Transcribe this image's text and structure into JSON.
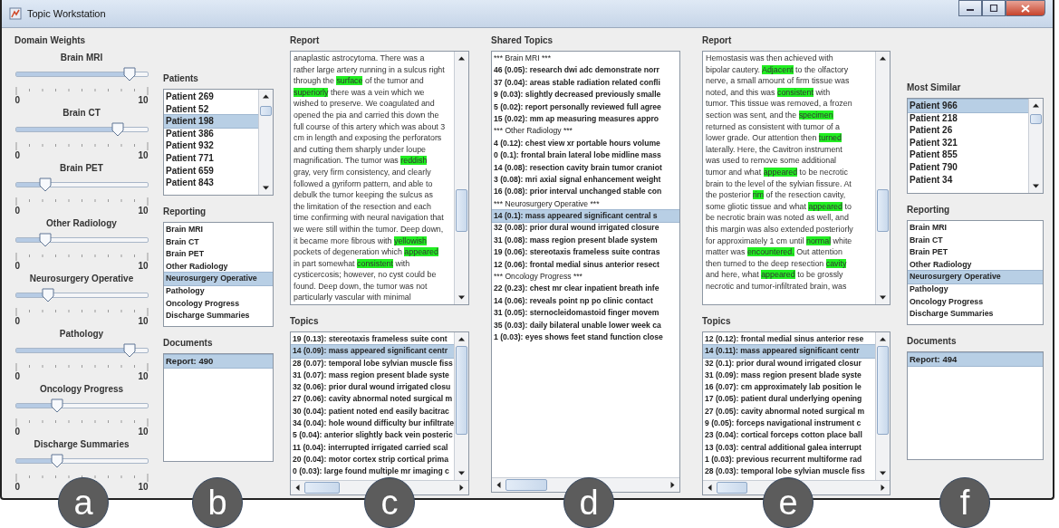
{
  "window": {
    "title": "Topic Workstation"
  },
  "domain_weights": {
    "title": "Domain Weights",
    "sliders": [
      {
        "label": "Brain MRI",
        "level": 0.9,
        "min": "0",
        "max": "10"
      },
      {
        "label": "Brain CT",
        "level": 0.8,
        "min": "0",
        "max": "10"
      },
      {
        "label": "Brain PET",
        "level": 0.2,
        "min": "0",
        "max": "10"
      },
      {
        "label": "Other Radiology",
        "level": 0.2,
        "min": "0",
        "max": "10"
      },
      {
        "label": "Neurosurgery Operative",
        "level": 0.22,
        "min": "0",
        "max": "10"
      },
      {
        "label": "Pathology",
        "level": 0.9,
        "min": "0",
        "max": "10"
      },
      {
        "label": "Oncology Progress",
        "level": 0.3,
        "min": "0",
        "max": "10"
      },
      {
        "label": "Discharge Summaries",
        "level": 0.3,
        "min": "0",
        "max": "10"
      }
    ]
  },
  "patients": {
    "title": "Patients",
    "items": [
      {
        "label": "Patient 269",
        "selected": false
      },
      {
        "label": "Patient 52",
        "selected": false
      },
      {
        "label": "Patient 198",
        "selected": true
      },
      {
        "label": "Patient 386",
        "selected": false
      },
      {
        "label": "Patient 932",
        "selected": false
      },
      {
        "label": "Patient 771",
        "selected": false
      },
      {
        "label": "Patient 659",
        "selected": false
      },
      {
        "label": "Patient 843",
        "selected": false
      }
    ]
  },
  "reporting_left": {
    "title": "Reporting",
    "items": [
      {
        "label": "Brain MRI",
        "selected": false
      },
      {
        "label": "Brain CT",
        "selected": false
      },
      {
        "label": "Brain PET",
        "selected": false
      },
      {
        "label": "Other Radiology",
        "selected": false
      },
      {
        "label": "Neurosurgery Operative",
        "selected": true
      },
      {
        "label": "Pathology",
        "selected": false
      },
      {
        "label": "Oncology Progress",
        "selected": false
      },
      {
        "label": "Discharge Summaries",
        "selected": false
      }
    ]
  },
  "documents_left": {
    "title": "Documents",
    "items": [
      {
        "label": "Report: 490",
        "selected": true
      }
    ]
  },
  "report_left": {
    "title": "Report",
    "lines": [
      [
        {
          "text": "anaplastic astrocytoma. There was a",
          "highlighted": false
        }
      ],
      [
        {
          "text": "rather large artery running in a sulcus right",
          "highlighted": false
        }
      ],
      [
        {
          "text": "through the ",
          "highlighted": false
        },
        {
          "text": "surface",
          "highlighted": true
        },
        {
          "text": " of the tumor and",
          "highlighted": false
        }
      ],
      [
        {
          "text": "superiorly",
          "highlighted": true
        },
        {
          "text": " there was a vein which we",
          "highlighted": false
        }
      ],
      [
        {
          "text": "wished to preserve. We coagulated and",
          "highlighted": false
        }
      ],
      [
        {
          "text": "opened the pia and carried this down the",
          "highlighted": false
        }
      ],
      [
        {
          "text": "full course of this artery which was about 3",
          "highlighted": false
        }
      ],
      [
        {
          "text": "cm in length and exposing the perforators",
          "highlighted": false
        }
      ],
      [
        {
          "text": "and cutting them sharply under loupe",
          "highlighted": false
        }
      ],
      [
        {
          "text": "magnification. The tumor was ",
          "highlighted": false
        },
        {
          "text": "reddish",
          "highlighted": true
        }
      ],
      [
        {
          "text": "gray, very firm consistency, and clearly",
          "highlighted": false
        }
      ],
      [
        {
          "text": "followed a gyriform pattern, and able to",
          "highlighted": false
        }
      ],
      [
        {
          "text": "debulk the tumor keeping the sulcus as",
          "highlighted": false
        }
      ],
      [
        {
          "text": "the limitation of the resection and each",
          "highlighted": false
        }
      ],
      [
        {
          "text": "time confirming with neural navigation that",
          "highlighted": false
        }
      ],
      [
        {
          "text": "we were still within the tumor. Deep down,",
          "highlighted": false
        }
      ],
      [
        {
          "text": "it became more fibrous with ",
          "highlighted": false
        },
        {
          "text": "yellowish",
          "highlighted": true
        }
      ],
      [
        {
          "text": "pockets of degeneration which ",
          "highlighted": false
        },
        {
          "text": "appeared",
          "highlighted": true
        }
      ],
      [
        {
          "text": "in part somewhat ",
          "highlighted": false
        },
        {
          "text": "consistent",
          "highlighted": true
        },
        {
          "text": " with",
          "highlighted": false
        }
      ],
      [
        {
          "text": "cysticercosis; however, no cyst could be",
          "highlighted": false
        }
      ],
      [
        {
          "text": "found. Deep down, the tumor was not",
          "highlighted": false
        }
      ],
      [
        {
          "text": "particularly vascular with minimal",
          "highlighted": false
        }
      ]
    ]
  },
  "topics_left": {
    "title": "Topics",
    "items": [
      {
        "label": "19 (0.13): stereotaxis frameless suite cont",
        "selected": false
      },
      {
        "label": "14 (0.09): mass appeared significant centr",
        "selected": true
      },
      {
        "label": "28 (0.07): temporal lobe sylvian muscle fiss",
        "selected": false
      },
      {
        "label": "31 (0.07): mass region present blade syste",
        "selected": false
      },
      {
        "label": "32 (0.06): prior dural wound irrigated closu",
        "selected": false
      },
      {
        "label": "27 (0.06): cavity abnormal noted surgical m",
        "selected": false
      },
      {
        "label": "30 (0.04): patient noted end easily bacitrac",
        "selected": false
      },
      {
        "label": "34 (0.04): hole wound difficulty bur infiltrate",
        "selected": false
      },
      {
        "label": "5 (0.04): anterior slightly back vein posteric",
        "selected": false
      },
      {
        "label": "11 (0.04): interrupted irrigated carried scal",
        "selected": false
      },
      {
        "label": "20 (0.04): motor cortex strip cortical prima",
        "selected": false
      },
      {
        "label": "0 (0.03): large found multiple mr imaging c",
        "selected": false
      }
    ]
  },
  "shared_topics": {
    "title": "Shared Topics",
    "items": [
      {
        "kind": "header",
        "label": "***   Brain MRI   ***",
        "selected": false
      },
      {
        "kind": "topic",
        "label": "46 (0.05): research dwi adc demonstrate norr",
        "selected": false
      },
      {
        "kind": "topic",
        "label": "37 (0.04): areas stable radiation related confli",
        "selected": false
      },
      {
        "kind": "topic",
        "label": "9 (0.03): slightly decreased previously smalle",
        "selected": false
      },
      {
        "kind": "topic",
        "label": "5 (0.02): report personally reviewed full agree",
        "selected": false
      },
      {
        "kind": "topic",
        "label": "15 (0.02): mm ap measuring measures appro",
        "selected": false
      },
      {
        "kind": "header",
        "label": "***   Other Radiology   ***",
        "selected": false
      },
      {
        "kind": "topic",
        "label": "4 (0.12): chest view xr portable hours volume",
        "selected": false
      },
      {
        "kind": "topic",
        "label": "0 (0.1): frontal brain lateral lobe midline mass",
        "selected": false
      },
      {
        "kind": "topic",
        "label": "14 (0.08): resection cavity brain tumor craniot",
        "selected": false
      },
      {
        "kind": "topic",
        "label": "3 (0.08): mri axial signal enhancement weight",
        "selected": false
      },
      {
        "kind": "topic",
        "label": "16 (0.08): prior interval unchanged stable con",
        "selected": false
      },
      {
        "kind": "header",
        "label": "***   Neurosurgery Operative   ***",
        "selected": false
      },
      {
        "kind": "topic",
        "label": "14 (0.1): mass appeared significant central s",
        "selected": true
      },
      {
        "kind": "topic",
        "label": "32 (0.08): prior dural wound irrigated closure",
        "selected": false
      },
      {
        "kind": "topic",
        "label": "31 (0.08): mass region present blade system",
        "selected": false
      },
      {
        "kind": "topic",
        "label": "19 (0.06): stereotaxis frameless suite contras",
        "selected": false
      },
      {
        "kind": "topic",
        "label": "12 (0.06): frontal medial sinus anterior resect",
        "selected": false
      },
      {
        "kind": "header",
        "label": "***   Oncology Progress   ***",
        "selected": false
      },
      {
        "kind": "topic",
        "label": "22 (0.23): chest mr clear inpatient breath infe",
        "selected": false
      },
      {
        "kind": "topic",
        "label": "14 (0.06): reveals point np po clinic contact",
        "selected": false
      },
      {
        "kind": "topic",
        "label": "31 (0.05): sternocleidomastoid finger movem",
        "selected": false
      },
      {
        "kind": "topic",
        "label": "35 (0.03): daily bilateral unable lower week ca",
        "selected": false
      },
      {
        "kind": "topic",
        "label": "1 (0.03): eyes shows feet stand function close",
        "selected": false
      }
    ]
  },
  "report_right": {
    "title": "Report",
    "lines": [
      [
        {
          "text": "Hemostasis was then achieved with",
          "highlighted": false
        }
      ],
      [
        {
          "text": "bipolar cautery. ",
          "highlighted": false
        },
        {
          "text": "Adjacent",
          "highlighted": true
        },
        {
          "text": " to the olfactory",
          "highlighted": false
        }
      ],
      [
        {
          "text": "nerve, a small amount of firm tissue was",
          "highlighted": false
        }
      ],
      [
        {
          "text": "noted, and this was ",
          "highlighted": false
        },
        {
          "text": "consistent",
          "highlighted": true
        },
        {
          "text": " with",
          "highlighted": false
        }
      ],
      [
        {
          "text": "tumor. This tissue was removed, a frozen",
          "highlighted": false
        }
      ],
      [
        {
          "text": "section was sent, and the ",
          "highlighted": false
        },
        {
          "text": "specimen",
          "highlighted": true
        }
      ],
      [
        {
          "text": "returned as consistent with tumor of a",
          "highlighted": false
        }
      ],
      [
        {
          "text": "lower grade. Our attention then ",
          "highlighted": false
        },
        {
          "text": "turned",
          "highlighted": true
        }
      ],
      [
        {
          "text": "laterally. Here, the Cavitron instrument",
          "highlighted": false
        }
      ],
      [
        {
          "text": "was used to remove some additional",
          "highlighted": false
        }
      ],
      [
        {
          "text": "tumor and what ",
          "highlighted": false
        },
        {
          "text": "appeared",
          "highlighted": true
        },
        {
          "text": " to be necrotic",
          "highlighted": false
        }
      ],
      [
        {
          "text": "brain to the level of the sylvian fissure. At",
          "highlighted": false
        }
      ],
      [
        {
          "text": "the posterior ",
          "highlighted": false
        },
        {
          "text": "rim",
          "highlighted": true
        },
        {
          "text": " of the resection cavity,",
          "highlighted": false
        }
      ],
      [
        {
          "text": "some gliotic tissue and what ",
          "highlighted": false
        },
        {
          "text": "appeared",
          "highlighted": true
        },
        {
          "text": " to",
          "highlighted": false
        }
      ],
      [
        {
          "text": "be necrotic brain was noted as well, and",
          "highlighted": false
        }
      ],
      [
        {
          "text": "this margin was also extended posteriorly",
          "highlighted": false
        }
      ],
      [
        {
          "text": "for approximately 1 cm until ",
          "highlighted": false
        },
        {
          "text": "normal",
          "highlighted": true
        },
        {
          "text": " white",
          "highlighted": false
        }
      ],
      [
        {
          "text": "matter was ",
          "highlighted": false
        },
        {
          "text": "encountered.",
          "highlighted": true
        },
        {
          "text": " Out attention",
          "highlighted": false
        }
      ],
      [
        {
          "text": "then turned to the deep resection ",
          "highlighted": false
        },
        {
          "text": "cavity",
          "highlighted": true
        }
      ],
      [
        {
          "text": "and here, what ",
          "highlighted": false
        },
        {
          "text": "appeared",
          "highlighted": true
        },
        {
          "text": " to be grossly",
          "highlighted": false
        }
      ],
      [
        {
          "text": "necrotic and tumor-infiltrated brain, was",
          "highlighted": false
        }
      ]
    ]
  },
  "topics_right": {
    "title": "Topics",
    "items": [
      {
        "label": "12 (0.12): frontal medial sinus anterior rese",
        "selected": false
      },
      {
        "label": "14 (0.11): mass appeared significant centr",
        "selected": true
      },
      {
        "label": "32 (0.1): prior dural wound irrigated closur",
        "selected": false
      },
      {
        "label": "31 (0.09): mass region present blade syste",
        "selected": false
      },
      {
        "label": "16 (0.07): cm approximately lab position le",
        "selected": false
      },
      {
        "label": "17 (0.05): patient dural underlying opening",
        "selected": false
      },
      {
        "label": "27 (0.05): cavity abnormal noted surgical m",
        "selected": false
      },
      {
        "label": "9 (0.05): forceps navigational instrument c",
        "selected": false
      },
      {
        "label": "23 (0.04): cortical forceps cotton place ball",
        "selected": false
      },
      {
        "label": "13 (0.03): central additional galea interrupt",
        "selected": false
      },
      {
        "label": "1 (0.03): previous recurrent multiforme rad",
        "selected": false
      },
      {
        "label": "28 (0.03): temporal lobe sylvian muscle fiss",
        "selected": false
      }
    ]
  },
  "most_similar": {
    "title": "Most Similar",
    "items": [
      {
        "label": "Patient 966",
        "selected": true
      },
      {
        "label": "Patient 218",
        "selected": false
      },
      {
        "label": "Patient 26",
        "selected": false
      },
      {
        "label": "Patient 321",
        "selected": false
      },
      {
        "label": "Patient 855",
        "selected": false
      },
      {
        "label": "Patient 790",
        "selected": false
      },
      {
        "label": "Patient 34",
        "selected": false
      }
    ]
  },
  "reporting_right": {
    "title": "Reporting",
    "items": [
      {
        "label": "Brain MRI",
        "selected": false
      },
      {
        "label": "Brain CT",
        "selected": false
      },
      {
        "label": "Brain PET",
        "selected": false
      },
      {
        "label": "Other Radiology",
        "selected": false
      },
      {
        "label": "Neurosurgery Operative",
        "selected": true
      },
      {
        "label": "Pathology",
        "selected": false
      },
      {
        "label": "Oncology Progress",
        "selected": false
      },
      {
        "label": "Discharge Summaries",
        "selected": false
      }
    ]
  },
  "documents_right": {
    "title": "Documents",
    "items": [
      {
        "label": "Report: 494",
        "selected": true
      }
    ]
  },
  "panel_labels": [
    "a",
    "b",
    "c",
    "d",
    "e",
    "f"
  ]
}
